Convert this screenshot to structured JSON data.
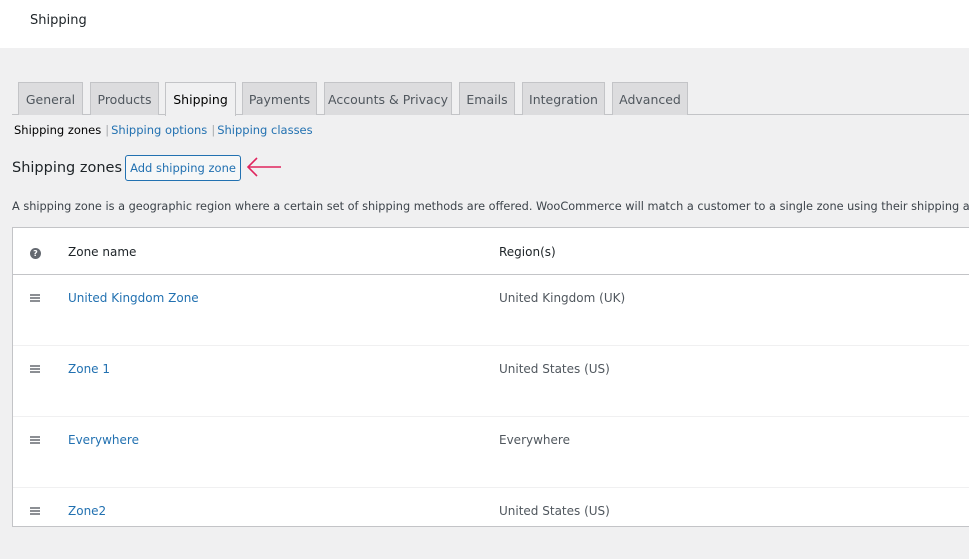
{
  "header": {
    "title": "Shipping"
  },
  "tabs": [
    {
      "label": "General",
      "active": false
    },
    {
      "label": "Products",
      "active": false
    },
    {
      "label": "Shipping",
      "active": true
    },
    {
      "label": "Payments",
      "active": false
    },
    {
      "label": "Accounts & Privacy",
      "active": false
    },
    {
      "label": "Emails",
      "active": false
    },
    {
      "label": "Integration",
      "active": false
    },
    {
      "label": "Advanced",
      "active": false
    }
  ],
  "subnav": {
    "current": "Shipping zones",
    "links": [
      "Shipping options",
      "Shipping classes"
    ],
    "separator": "|"
  },
  "section": {
    "heading": "Shipping zones",
    "add_button": "Add shipping zone",
    "annotation_arrow_color": "#e0245e",
    "description": "A shipping zone is a geographic region where a certain set of shipping methods are offered. WooCommerce will match a customer to a single zone using their shipping address and prese"
  },
  "table": {
    "help_icon": "?",
    "columns": [
      "Zone name",
      "Region(s)"
    ],
    "rows": [
      {
        "zone": "United Kingdom Zone",
        "region": "United Kingdom (UK)"
      },
      {
        "zone": "Zone 1",
        "region": "United States (US)"
      },
      {
        "zone": "Everywhere",
        "region": "Everywhere"
      },
      {
        "zone": "Zone2",
        "region": "United States (US)"
      }
    ]
  },
  "colors": {
    "link": "#2271b1",
    "background": "#f0f0f1",
    "tab_inactive": "#dcdcde"
  }
}
